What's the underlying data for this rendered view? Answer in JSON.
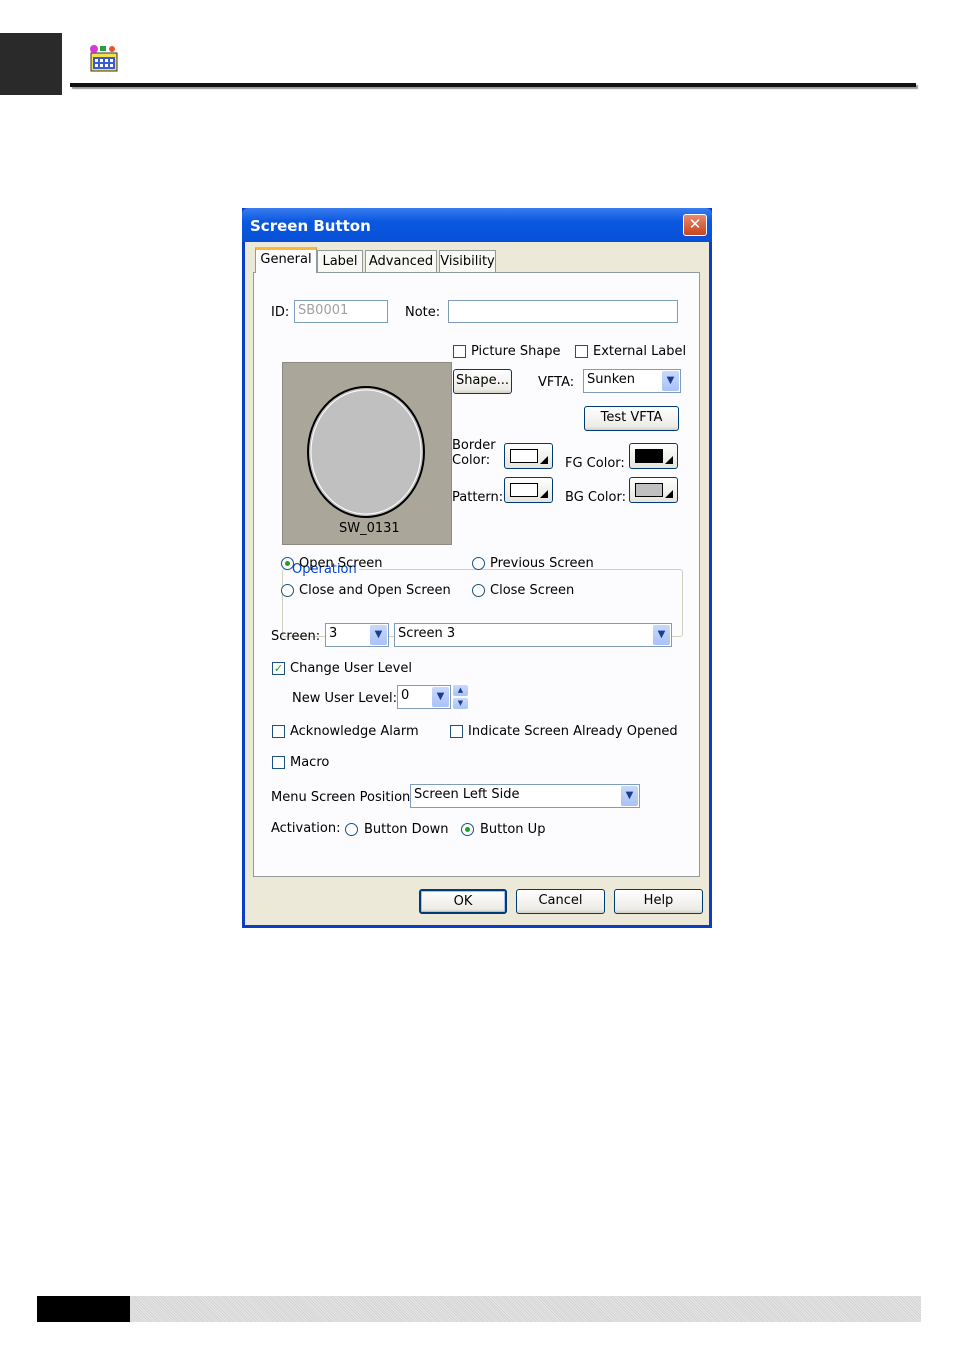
{
  "dialog": {
    "title": "Screen Button",
    "close_glyph": "✕",
    "tabs": [
      "General",
      "Label",
      "Advanced",
      "Visibility"
    ],
    "active_tab": "General"
  },
  "general": {
    "id_label": "ID:",
    "id_value": "SB0001",
    "note_label": "Note:",
    "note_value": "",
    "preview_caption": "SW_0131",
    "picture_shape_label": "Picture Shape",
    "picture_shape_checked": false,
    "external_label_label": "External Label",
    "external_label_checked": false,
    "shape_button": "Shape...",
    "vfta_label": "VFTA:",
    "vfta_value": "Sunken",
    "test_vfta_button": "Test VFTA",
    "border_color_label_1": "Border",
    "border_color_label_2": "Color:",
    "fg_color_label": "FG Color:",
    "pattern_label": "Pattern:",
    "bg_color_label": "BG Color:",
    "colors": {
      "border": "#ffffff",
      "fg": "#000000",
      "pattern": "#ffffff",
      "bg": "#c0c0c0",
      "preview_bg": "#aaa79a",
      "preview_circle": "#c0c0c0"
    }
  },
  "operation": {
    "title": "Operation",
    "options": [
      "Open Screen",
      "Previous Screen",
      "Close and Open Screen",
      "Close Screen"
    ],
    "selected": "Open Screen"
  },
  "screen": {
    "label": "Screen:",
    "number": "3",
    "name": "Screen 3"
  },
  "user_level": {
    "change_label": "Change User Level",
    "change_checked": true,
    "new_level_label": "New User Level:",
    "new_level_value": "0"
  },
  "options": {
    "acknowledge_alarm": "Acknowledge Alarm",
    "indicate_opened": "Indicate Screen Already Opened",
    "macro": "Macro"
  },
  "menu_position": {
    "label": "Menu Screen Position:",
    "value": "Screen Left Side"
  },
  "activation": {
    "label": "Activation:",
    "options": [
      "Button Down",
      "Button Up"
    ],
    "selected": "Button Up"
  },
  "footer_buttons": {
    "ok": "OK",
    "cancel": "Cancel",
    "help": "Help"
  },
  "icons": {
    "dropdown": "▼",
    "spin_up": "▲",
    "spin_down": "▼",
    "check": "✓"
  }
}
